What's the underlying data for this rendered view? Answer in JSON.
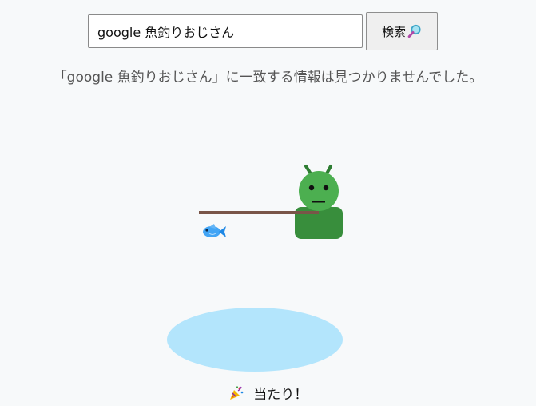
{
  "search": {
    "query": "google 魚釣りおじさん",
    "button_label": "検索",
    "button_icon": "magnifier-icon"
  },
  "result": {
    "message": "「google 魚釣りおじさん」に一致する情報は見つかりませんでした。"
  },
  "game": {
    "status_icon": "party-popper-icon",
    "status_text": "当たり！"
  },
  "colors": {
    "page_background": "#f7f9fa",
    "character_head": "#4caf50",
    "character_body": "#388e3c",
    "fishing_rod": "#795548",
    "pond": "#b3e5fc",
    "fish": "#42a5f5"
  }
}
